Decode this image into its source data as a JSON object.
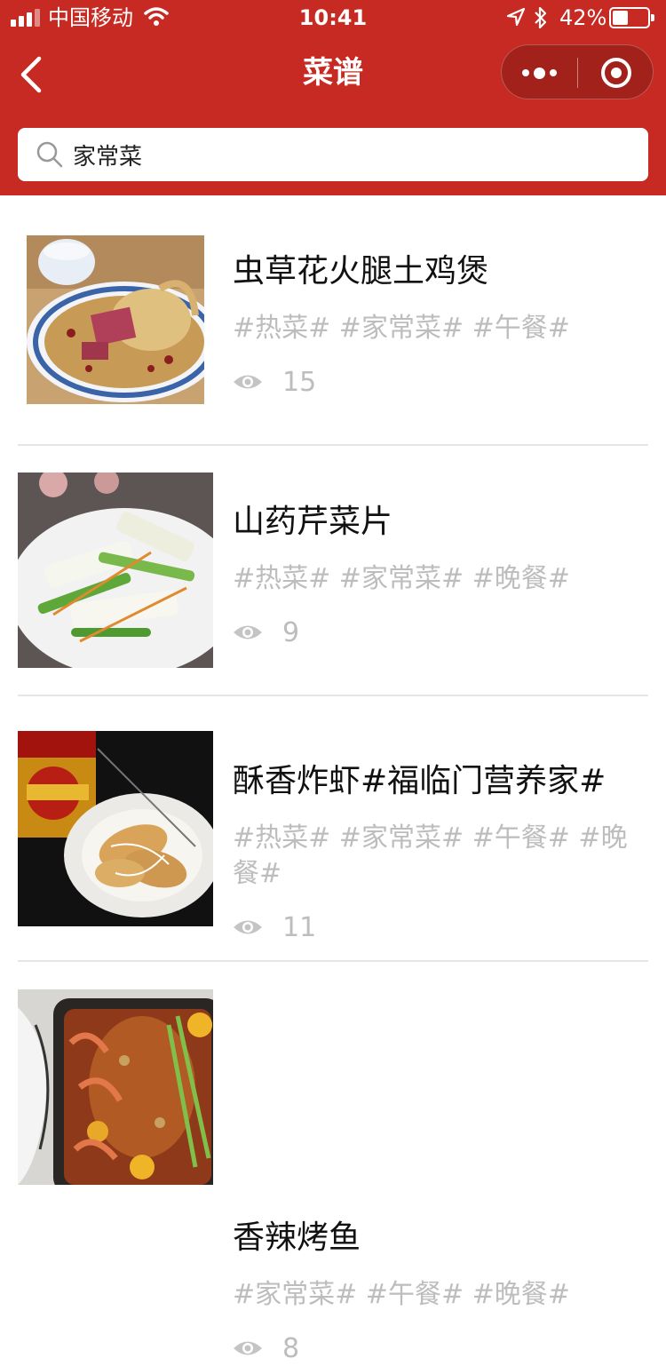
{
  "status_bar": {
    "carrier": "中国移动",
    "time": "10:41",
    "battery": "42%",
    "battery_level": 0.42
  },
  "nav": {
    "title": "菜谱"
  },
  "search": {
    "value": "家常菜"
  },
  "colors": {
    "header": "#c62a22",
    "tag": "#bdbdbd",
    "title": "#111111"
  },
  "recipes": [
    {
      "title": "虫草花火腿土鸡煲",
      "tags": "#热菜# #家常菜# #午餐#",
      "views": "15",
      "image": "chicken-soup-photo"
    },
    {
      "title": "山药芹菜片",
      "tags": "#热菜# #家常菜# #晚餐#",
      "views": "9",
      "image": "yam-celery-photo"
    },
    {
      "title": "酥香炸虾#福临门营养家#",
      "tags": "#热菜# #家常菜# #午餐# #晚餐#",
      "views": "11",
      "image": "fried-shrimp-photo"
    },
    {
      "title": "香辣烤鱼",
      "tags": "#家常菜# #午餐# #晚餐#",
      "views": "8",
      "image": "grilled-fish-photo"
    }
  ]
}
